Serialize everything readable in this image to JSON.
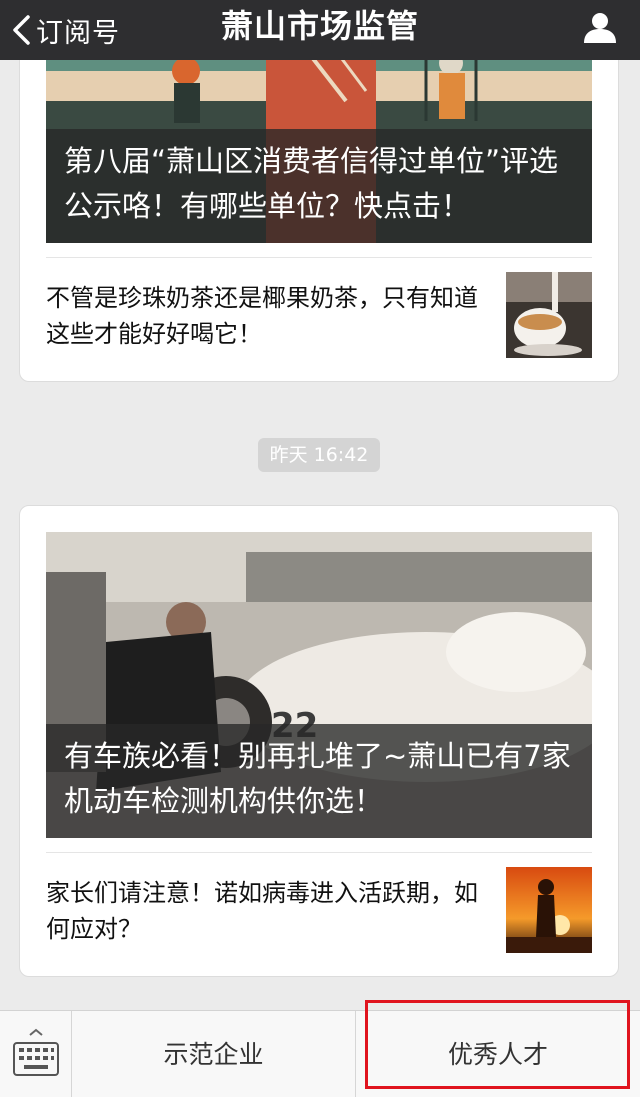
{
  "navbar": {
    "back_label": "订阅号",
    "title": "萧山市场监管",
    "back_icon": "chevron-left-icon",
    "profile_icon": "person-icon"
  },
  "feed": {
    "card1": {
      "cover_title": "第八届“萧山区消费者信得过单位”评选公示咯！有哪些单位？快点击！",
      "sub_title": "不管是珍珠奶茶还是椰果奶茶，只有知道这些才能好好喝它！"
    },
    "timestamp": "昨天 16:42",
    "card2": {
      "cover_title": "有车族必看！别再扎堆了~萧山已有7家机动车检测机构供你选！",
      "sub_title": "家长们请注意！诺如病毒进入活跃期，如何应对？"
    }
  },
  "menubar": {
    "keyboard_icon": "keyboard-icon",
    "items": [
      {
        "label": "示范企业"
      },
      {
        "label": "优秀人才"
      }
    ],
    "highlight_color": "#e0141e"
  }
}
